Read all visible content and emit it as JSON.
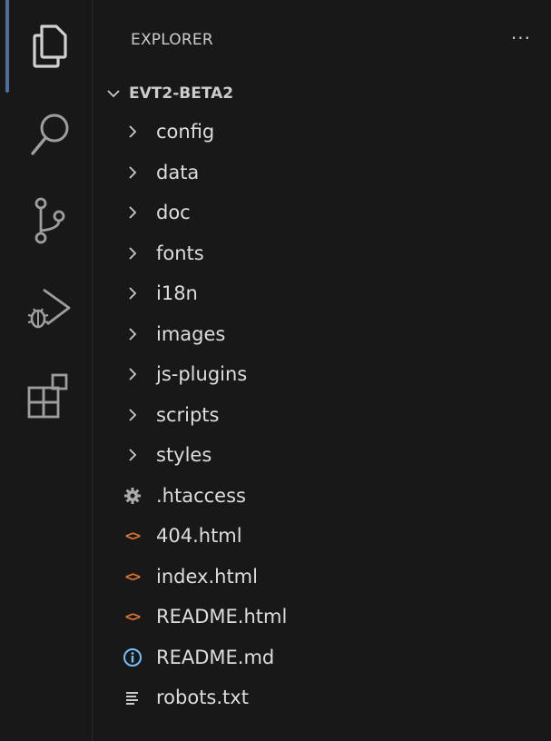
{
  "explorer": {
    "title": "EXPLORER",
    "more_label": "···",
    "root": "EVT2-BETA2",
    "items": [
      {
        "label": "config",
        "kind": "folder"
      },
      {
        "label": "data",
        "kind": "folder"
      },
      {
        "label": "doc",
        "kind": "folder"
      },
      {
        "label": "fonts",
        "kind": "folder"
      },
      {
        "label": "i18n",
        "kind": "folder"
      },
      {
        "label": "images",
        "kind": "folder"
      },
      {
        "label": "js-plugins",
        "kind": "folder"
      },
      {
        "label": "scripts",
        "kind": "folder"
      },
      {
        "label": "styles",
        "kind": "folder"
      },
      {
        "label": ".htaccess",
        "kind": "file",
        "icon": "gear-icon"
      },
      {
        "label": "404.html",
        "kind": "file",
        "icon": "html-icon"
      },
      {
        "label": "index.html",
        "kind": "file",
        "icon": "html-icon"
      },
      {
        "label": "README.html",
        "kind": "file",
        "icon": "html-icon"
      },
      {
        "label": "README.md",
        "kind": "file",
        "icon": "info-icon"
      },
      {
        "label": "robots.txt",
        "kind": "file",
        "icon": "text-lines-icon"
      }
    ]
  },
  "activity_bar": {
    "items": [
      "files-icon",
      "search-icon",
      "source-control-icon",
      "run-debug-icon",
      "extensions-icon"
    ],
    "active": "files-icon"
  },
  "colors": {
    "background": "#181818",
    "text": "#cccccc",
    "icon": "#bbbbbb",
    "html_icon": "#e37933",
    "info_icon": "#75beff",
    "active_indicator": "#4f6f99"
  }
}
